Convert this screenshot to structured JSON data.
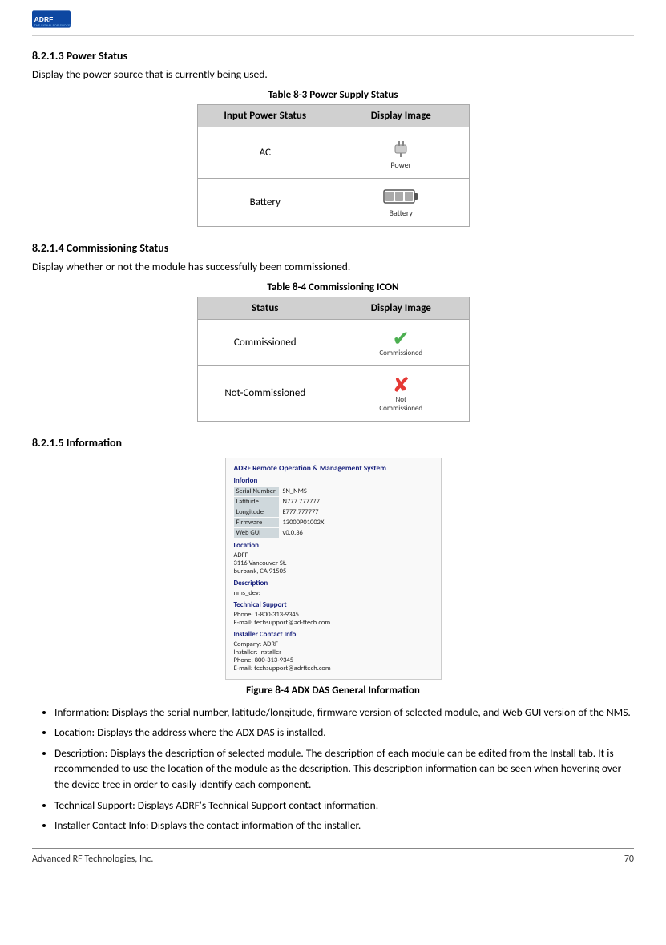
{
  "header": {
    "logo_alt": "ADRF THE SIGNAL FOR SUCCESS",
    "tagline": "THE SIGNAL FOR SUCCESS"
  },
  "sections": {
    "s8213": {
      "heading": "8.2.1.3   Power Status",
      "body": "Display the power source that is currently being used.",
      "table_caption": "Table 8-3      Power Supply Status",
      "table_headers": [
        "Input Power Status",
        "Display Image"
      ],
      "table_rows": [
        {
          "status": "AC",
          "image_label": "Power"
        },
        {
          "status": "Battery",
          "image_label": "Battery"
        }
      ]
    },
    "s8214": {
      "heading": "8.2.1.4   Commissioning Status",
      "body": "Display whether or not the module has successfully been commissioned.",
      "table_caption": "Table 8-4      Commissioning ICON",
      "table_headers": [
        "Status",
        "Display Image"
      ],
      "table_rows": [
        {
          "status": "Commissioned",
          "image_label": "Commissioned"
        },
        {
          "status": "Not-Commissioned",
          "image_label": "Not-Commissioned"
        }
      ]
    },
    "s8215": {
      "heading": "8.2.1.5   Information",
      "figure_caption": "Figure 8-4      ADX DAS General Information",
      "info_sys_title": "ADRF Remote Operation & Management System",
      "info_section1": "Inforion",
      "info_rows": [
        {
          "label": "Serial Number",
          "value": "SN_NMS"
        },
        {
          "label": "Latitude",
          "value": "N777.777777"
        },
        {
          "label": "Longitude",
          "value": "E777.777777"
        },
        {
          "label": "Firmware",
          "value": "13000P01002X"
        },
        {
          "label": "Web GUI",
          "value": "v0.0.36"
        }
      ],
      "info_location_title": "Location",
      "info_location_lines": [
        "ADFF",
        "3116 Vancouver St.",
        "burbank, CA 91505"
      ],
      "info_desc_title": "Description",
      "info_desc_value": "nms_dev:",
      "info_tech_title": "Technical Support",
      "info_tech_lines": [
        "Phone: 1-800-313-9345",
        "E-mail: techsupport@ad-ftech.com"
      ],
      "info_installer_title": "Installer Contact Info",
      "info_installer_lines": [
        "Company: ADRF",
        "Installer: Installer",
        "Phone: 800-313-9345",
        "E-mail: techsupport@adrftech.com"
      ],
      "bullets": [
        "Information: Displays the serial number, latitude/longitude, firmware version of selected module, and Web GUI version of the NMS.",
        "Location: Displays the address where the ADX DAS is installed.",
        "Description: Displays the description of selected module.  The description of each module can be edited from the Install tab.  It is recommended to use the location of the module as the description.  This description information can be seen when hovering over the device tree in order to easily identify each component.",
        "Technical Support: Displays ADRF's Technical Support contact information.",
        "Installer Contact Info: Displays the contact information of the installer."
      ]
    }
  },
  "footer": {
    "left": "Advanced RF Technologies, Inc.",
    "right": "70"
  }
}
